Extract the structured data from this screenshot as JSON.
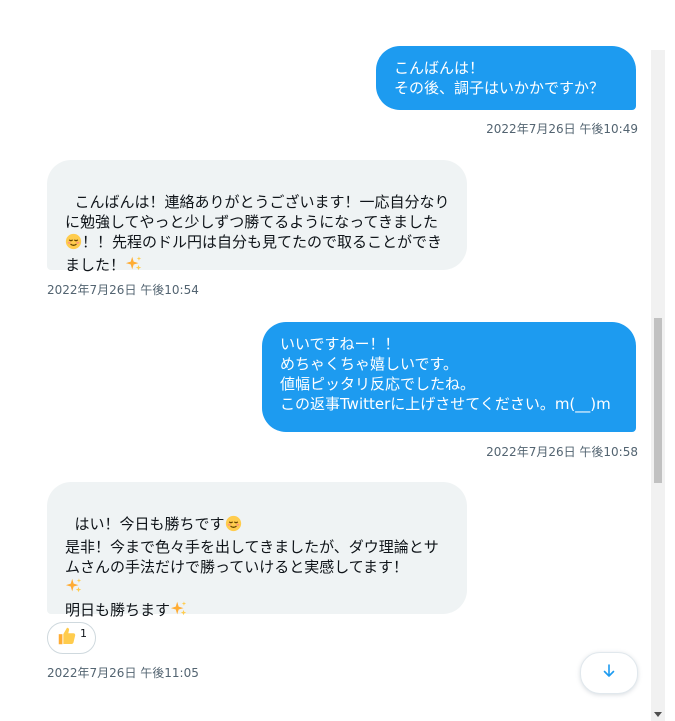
{
  "messages": [
    {
      "direction": "out",
      "text": "こんばんは！\nその後、調子はいかかですか？",
      "time": "2022年7月26日 午後10:49"
    },
    {
      "direction": "in",
      "text_a": "こんばんは！連絡ありがとうございます！一応自分なりに勉強してやっと少しずつ勝てるようになってきました",
      "text_b": "！！先程のドル円は自分も見てたので取ることができました！",
      "time": "2022年7月26日 午後10:54"
    },
    {
      "direction": "out",
      "text": "いいですねー！！\nめちゃくちゃ嬉しいです。\n値幅ピッタリ反応でしたね。\nこの返事Twitterに上げさせてください。m(__)m",
      "time": "2022年7月26日 午後10:58"
    },
    {
      "direction": "in",
      "line1": "はい！今日も勝ちです",
      "line2": "是非！今まで色々手を出してきましたが、ダウ理論とサムさんの手法だけで勝っていけると実感してます！",
      "line3": "明日も勝ちます",
      "reaction_count": "1",
      "time": "2022年7月26日 午後11:05"
    }
  ],
  "icons": {
    "relieved_face": "relieved-face-emoji",
    "sparkles": "sparkles-emoji",
    "thumbs_up": "thumbs-up-emoji",
    "scroll_down": "arrow-down-icon"
  },
  "colors": {
    "outgoing_bubble": "#1d9bf0",
    "incoming_bubble": "#eff3f4",
    "timestamp": "#536471",
    "accent": "#1d9bf0"
  }
}
